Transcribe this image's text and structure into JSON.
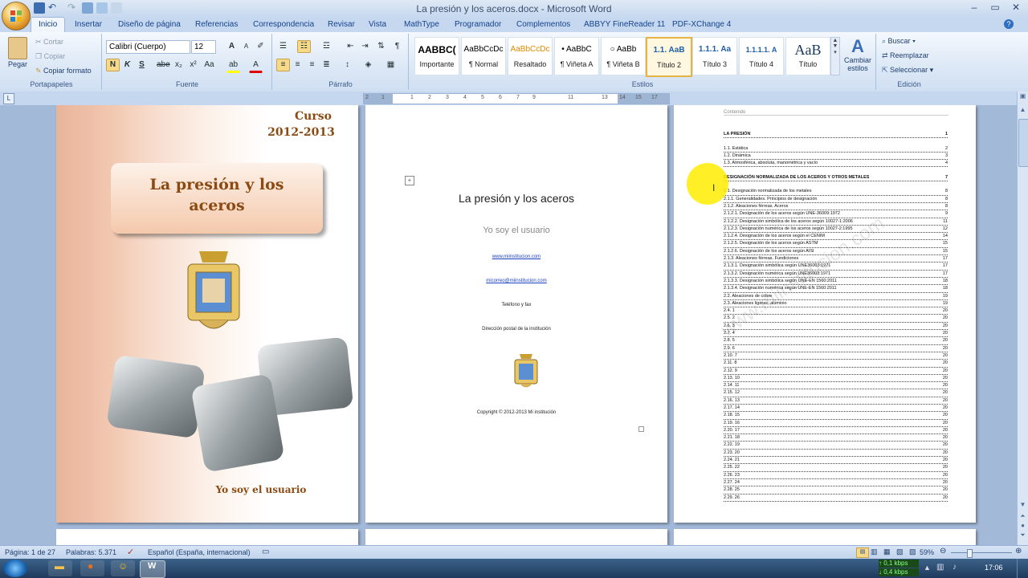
{
  "window": {
    "title": "La presión y los aceros.docx - Microsoft Word"
  },
  "tabs": [
    "Inicio",
    "Insertar",
    "Diseño de página",
    "Referencias",
    "Correspondencia",
    "Revisar",
    "Vista",
    "MathType",
    "Programador",
    "Complementos",
    "ABBYY FineReader 11",
    "PDF-XChange 4"
  ],
  "clipboard": {
    "paste": "Pegar",
    "cut": "Cortar",
    "copy": "Copiar",
    "format_painter": "Copiar formato",
    "label": "Portapapeles"
  },
  "font": {
    "name": "Calibri (Cuerpo)",
    "size": "12",
    "label": "Fuente"
  },
  "paragraph": {
    "label": "Párrafo"
  },
  "styles": {
    "label": "Estilos",
    "items": [
      {
        "preview": "AABBC(",
        "name": "Importante"
      },
      {
        "preview": "AaBbCcDc",
        "name": "¶ Normal"
      },
      {
        "preview": "AaBbCcDc",
        "name": "Resaltado"
      },
      {
        "preview": "• AaBbC",
        "name": "¶ Viñeta A"
      },
      {
        "preview": "○ AaBb",
        "name": "¶ Viñeta B"
      },
      {
        "preview": "1.1. AaB",
        "name": "Título 2"
      },
      {
        "preview": "1.1.1. Aa",
        "name": "Título 3"
      },
      {
        "preview": "1.1.1.1. A",
        "name": "Título 4"
      },
      {
        "preview": "AaB",
        "name": "Título"
      }
    ],
    "change": "Cambiar estilos"
  },
  "editing": {
    "find": "Buscar",
    "replace": "Reemplazar",
    "select": "Seleccionar",
    "label": "Edición"
  },
  "ruler": {
    "ticks": [
      "2",
      "1",
      "1",
      "2",
      "3",
      "4",
      "5",
      "6",
      "7",
      "8",
      "9",
      "10",
      "11",
      "12",
      "13",
      "14",
      "15",
      "16",
      "17",
      "18"
    ]
  },
  "page1": {
    "course": "Curso",
    "years": "2012-2013",
    "title": "La presión y los aceros",
    "user": "Yo soy el usuario"
  },
  "page2": {
    "title": "La presión y los aceros",
    "user": "Yo soy el usuario",
    "web": "www.miinstitucion.com",
    "email": "micorreo@miinstitucion.com",
    "phone": "Teléfono y fax",
    "address": "Dirección postal de la institución",
    "copyright": "Copyright © 2012-2013 Mi institución"
  },
  "page3": {
    "header": "Contenido",
    "watermark": "www.miinstitucion.com",
    "toc": [
      {
        "t": "LA PRESIÓN",
        "p": "1",
        "main": true
      },
      {
        "t": "",
        "p": ""
      },
      {
        "t": "1.1. Estática",
        "p": "2"
      },
      {
        "t": "1.2. Dinámica",
        "p": "3"
      },
      {
        "t": "1.3. Atmosférica, absoluta, manométrica y vacío",
        "p": "4"
      },
      {
        "t": "",
        "p": ""
      },
      {
        "t": "DESIGNACIÓN NORMALIZADA DE LOS ACEROS Y OTROS METALES",
        "p": "7",
        "main": true
      },
      {
        "t": "",
        "p": ""
      },
      {
        "t": "2.1. Designación normalizada de los metales",
        "p": "8"
      },
      {
        "t": "2.1.1. Generalidades. Principios de designación",
        "p": "8"
      },
      {
        "t": "2.1.2. Aleaciones férreas. Aceros",
        "p": "8"
      },
      {
        "t": "2.1.2.1. Designación de los aceros según UNE-36009:1972",
        "p": "9"
      },
      {
        "t": "2.1.2.2. Designación simbólica de los aceros según 10027-1:2006",
        "p": "11"
      },
      {
        "t": "2.1.2.3. Designación numérica de los aceros según 10027-2:1995",
        "p": "12"
      },
      {
        "t": "2.1.2.4. Designación de los aceros según el CENIM",
        "p": "14"
      },
      {
        "t": "2.1.2.5. Designación de los aceros según ASTM",
        "p": "15"
      },
      {
        "t": "2.1.2.6. Designación de los aceros según AISI",
        "p": "15"
      },
      {
        "t": "2.1.3. Aleaciones férreas. Fundiciones",
        "p": "17"
      },
      {
        "t": "2.1.3.1. Designación simbólica según UNE36003:1971",
        "p": "17"
      },
      {
        "t": "2.1.3.2. Designación numérica según UNE36003:1971",
        "p": "17"
      },
      {
        "t": "2.1.3.3. Designación simbólica según UNE-EN 1560:2011",
        "p": "18"
      },
      {
        "t": "2.1.3.4. Designación numérica según UNE-EN 1560:2011",
        "p": "18"
      },
      {
        "t": "2.2. Aleaciones de cobre",
        "p": "19"
      },
      {
        "t": "2.3. Aleaciones ligeras, aluminio",
        "p": "19"
      },
      {
        "t": "2.4. 1",
        "p": "20"
      },
      {
        "t": "2.5. 2",
        "p": "20"
      },
      {
        "t": "2.6. 3",
        "p": "20"
      },
      {
        "t": "2.7. 4",
        "p": "20"
      },
      {
        "t": "2.8. 5",
        "p": "20"
      },
      {
        "t": "2.9. 6",
        "p": "20"
      },
      {
        "t": "2.10. 7",
        "p": "20"
      },
      {
        "t": "2.11. 8",
        "p": "20"
      },
      {
        "t": "2.12. 9",
        "p": "20"
      },
      {
        "t": "2.13. 10",
        "p": "20"
      },
      {
        "t": "2.14. 11",
        "p": "20"
      },
      {
        "t": "2.15. 12",
        "p": "20"
      },
      {
        "t": "2.16. 13",
        "p": "20"
      },
      {
        "t": "2.17. 14",
        "p": "20"
      },
      {
        "t": "2.18. 15",
        "p": "20"
      },
      {
        "t": "2.19. 16",
        "p": "20"
      },
      {
        "t": "2.20. 17",
        "p": "20"
      },
      {
        "t": "2.21. 18",
        "p": "20"
      },
      {
        "t": "2.22. 19",
        "p": "20"
      },
      {
        "t": "2.23. 20",
        "p": "20"
      },
      {
        "t": "2.24. 21",
        "p": "20"
      },
      {
        "t": "2.25. 22",
        "p": "20"
      },
      {
        "t": "2.26. 23",
        "p": "20"
      },
      {
        "t": "2.27. 24",
        "p": "20"
      },
      {
        "t": "2.28. 25",
        "p": "20"
      },
      {
        "t": "2.29. 26",
        "p": "20"
      }
    ]
  },
  "status": {
    "page": "Página: 1 de 27",
    "words": "Palabras: 5.371",
    "language": "Español (España, internacional)",
    "zoom": "59%"
  },
  "taskbar": {
    "net_up": "0,1 kbps",
    "net_down": "0,4 kbps",
    "clock": "17:06"
  }
}
